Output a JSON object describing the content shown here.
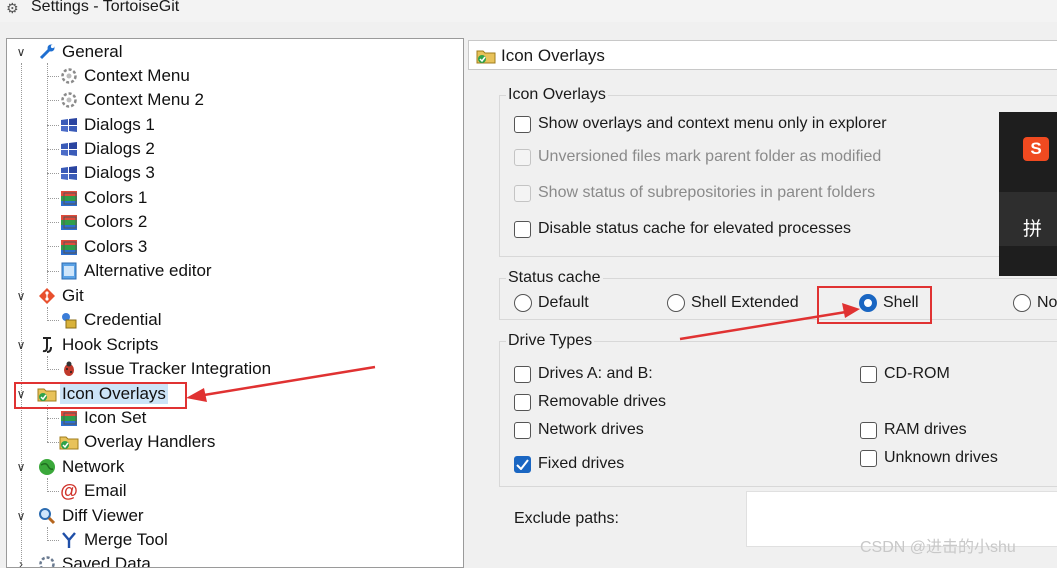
{
  "window": {
    "title": "Settings - TortoiseGit",
    "icon": "tortoisegit-gear-icon"
  },
  "tree": {
    "items": [
      {
        "label": "General",
        "icon": "wrench-icon",
        "expanded": true
      },
      {
        "label": "Context Menu",
        "icon": "gear-icon"
      },
      {
        "label": "Context Menu 2",
        "icon": "gear-icon"
      },
      {
        "label": "Dialogs 1",
        "icon": "windows-flag-icon"
      },
      {
        "label": "Dialogs 2",
        "icon": "windows-flag-icon"
      },
      {
        "label": "Dialogs 3",
        "icon": "windows-flag-icon"
      },
      {
        "label": "Colors 1",
        "icon": "colors-icon"
      },
      {
        "label": "Colors 2",
        "icon": "colors-icon"
      },
      {
        "label": "Colors 3",
        "icon": "colors-icon"
      },
      {
        "label": "Alternative editor",
        "icon": "editor-icon"
      },
      {
        "label": "Git",
        "icon": "git-icon",
        "expanded": true
      },
      {
        "label": "Credential",
        "icon": "credential-icon"
      },
      {
        "label": "Hook Scripts",
        "icon": "hook-icon",
        "expanded": true
      },
      {
        "label": "Issue Tracker Integration",
        "icon": "bug-icon"
      },
      {
        "label": "Icon Overlays",
        "icon": "overlay-folder-icon",
        "expanded": true,
        "selected": true
      },
      {
        "label": "Icon Set",
        "icon": "colors-icon"
      },
      {
        "label": "Overlay Handlers",
        "icon": "overlay-folder-icon"
      },
      {
        "label": "Network",
        "icon": "globe-icon",
        "expanded": true
      },
      {
        "label": "Email",
        "icon": "at-sign-icon"
      },
      {
        "label": "Diff Viewer",
        "icon": "magnifier-icon",
        "expanded": true
      },
      {
        "label": "Merge Tool",
        "icon": "merge-icon"
      },
      {
        "label": "Saved Data",
        "icon": "gear-icon"
      }
    ]
  },
  "panel": {
    "title": "Icon Overlays",
    "icon_overlays_group": {
      "title": "Icon Overlays",
      "options": [
        {
          "label": "Show overlays and context menu only in explorer",
          "checked": false,
          "enabled": true
        },
        {
          "label": "Unversioned files mark parent folder as modified",
          "checked": false,
          "enabled": false
        },
        {
          "label": "Show status of subrepositories in parent folders",
          "checked": false,
          "enabled": false
        },
        {
          "label": "Disable status cache for elevated processes",
          "checked": false,
          "enabled": true
        }
      ]
    },
    "status_cache": {
      "title": "Status cache",
      "options": [
        {
          "label": "Default",
          "selected": false
        },
        {
          "label": "Shell Extended",
          "selected": false
        },
        {
          "label": "Shell",
          "selected": true
        },
        {
          "label": "No",
          "selected": false
        }
      ]
    },
    "drive_types": {
      "title": "Drive Types",
      "options": [
        {
          "label": "Drives A: and B:",
          "checked": false
        },
        {
          "label": "Removable drives",
          "checked": false
        },
        {
          "label": "Network drives",
          "checked": false
        },
        {
          "label": "Fixed drives",
          "checked": true
        },
        {
          "label": "CD-ROM",
          "checked": false
        },
        {
          "label": "RAM drives",
          "checked": false
        },
        {
          "label": "Unknown drives",
          "checked": false
        }
      ]
    },
    "exclude_paths": {
      "label": "Exclude paths:",
      "value": ""
    }
  },
  "ime": {
    "logo": "S",
    "pinyin": "拼"
  },
  "watermark": "CSDN @进击的小shu",
  "annotation_color": "#e03232",
  "accent_color": "#1a66c2"
}
